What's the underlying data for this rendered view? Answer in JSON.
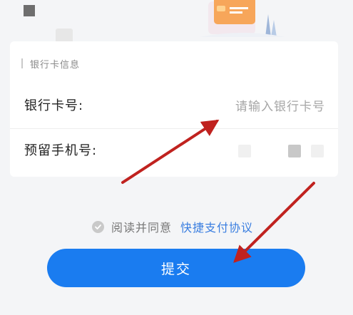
{
  "card": {
    "section_title": "银行卡信息",
    "fields": [
      {
        "label": "银行卡号:",
        "placeholder": "请输入银行卡号",
        "value": ""
      },
      {
        "label": "预留手机号:"
      }
    ]
  },
  "agreement": {
    "prefix": "阅读并同意",
    "link_text": "快捷支付协议"
  },
  "submit_label": "提交",
  "colors": {
    "primary": "#1a7cf0",
    "link": "#3a7ee0",
    "annotation_arrow": "#c0221f"
  }
}
